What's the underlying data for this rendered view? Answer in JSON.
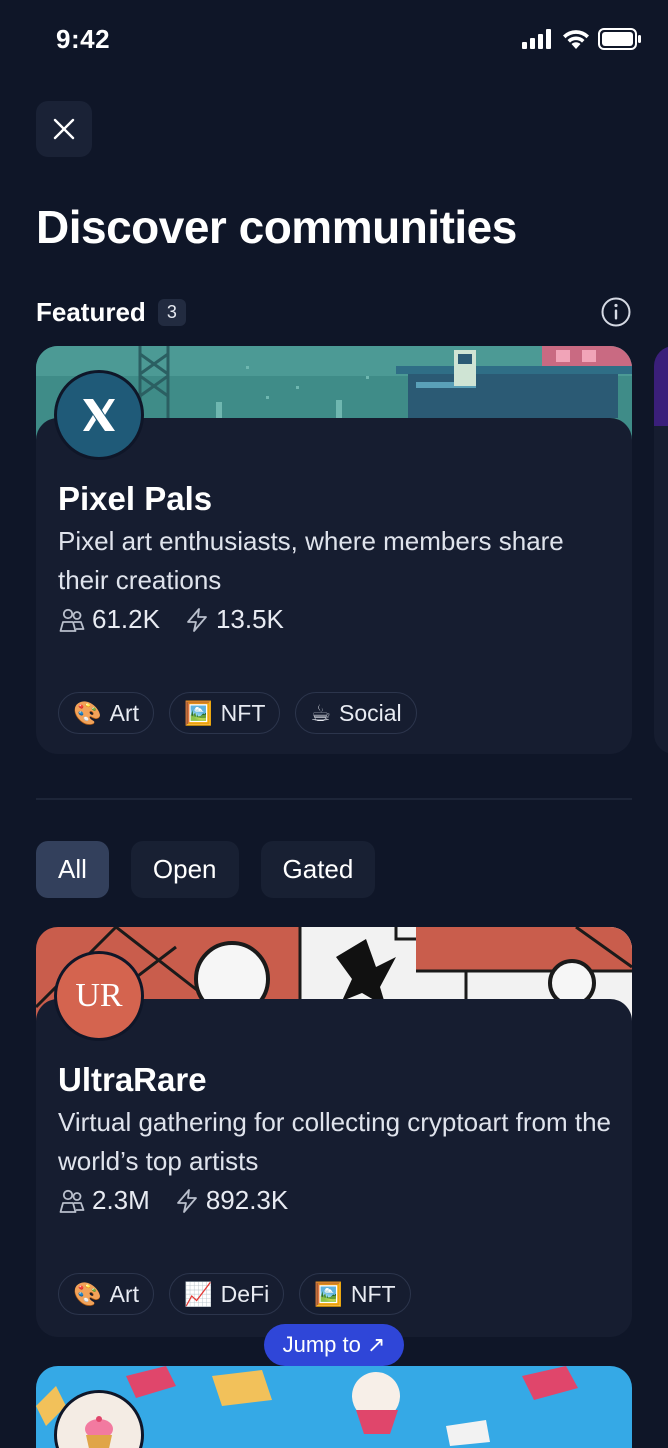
{
  "status_bar": {
    "time": "9:42"
  },
  "header": {
    "title": "Discover communities"
  },
  "featured": {
    "label": "Featured",
    "count": "3",
    "card": {
      "avatar_letter": "X",
      "name": "Pixel Pals",
      "description": "Pixel art enthusiasts, where members share their creations",
      "members": "61.2K",
      "activity": "13.5K",
      "tags": [
        {
          "emoji": "🎨",
          "label": "Art"
        },
        {
          "emoji": "🖼️",
          "label": "NFT"
        },
        {
          "emoji": "☕",
          "label": "Social"
        }
      ]
    }
  },
  "filters": [
    {
      "label": "All",
      "active": true
    },
    {
      "label": "Open",
      "active": false
    },
    {
      "label": "Gated",
      "active": false
    }
  ],
  "communities": [
    {
      "avatar_text": "UR",
      "name": "UltraRare",
      "description": "Virtual gathering for collecting cryptoart from the world’s top artists",
      "members": "2.3M",
      "activity": "892.3K",
      "tags": [
        {
          "emoji": "🎨",
          "label": "Art"
        },
        {
          "emoji": "📈",
          "label": "DeFi"
        },
        {
          "emoji": "🖼️",
          "label": "NFT"
        }
      ]
    }
  ],
  "jump_button": {
    "label": "Jump to ↗"
  },
  "colors": {
    "background": "#0f1628",
    "card": "#161d30",
    "accent": "#2f46d8",
    "ultrarare_avatar": "#d4644f"
  }
}
